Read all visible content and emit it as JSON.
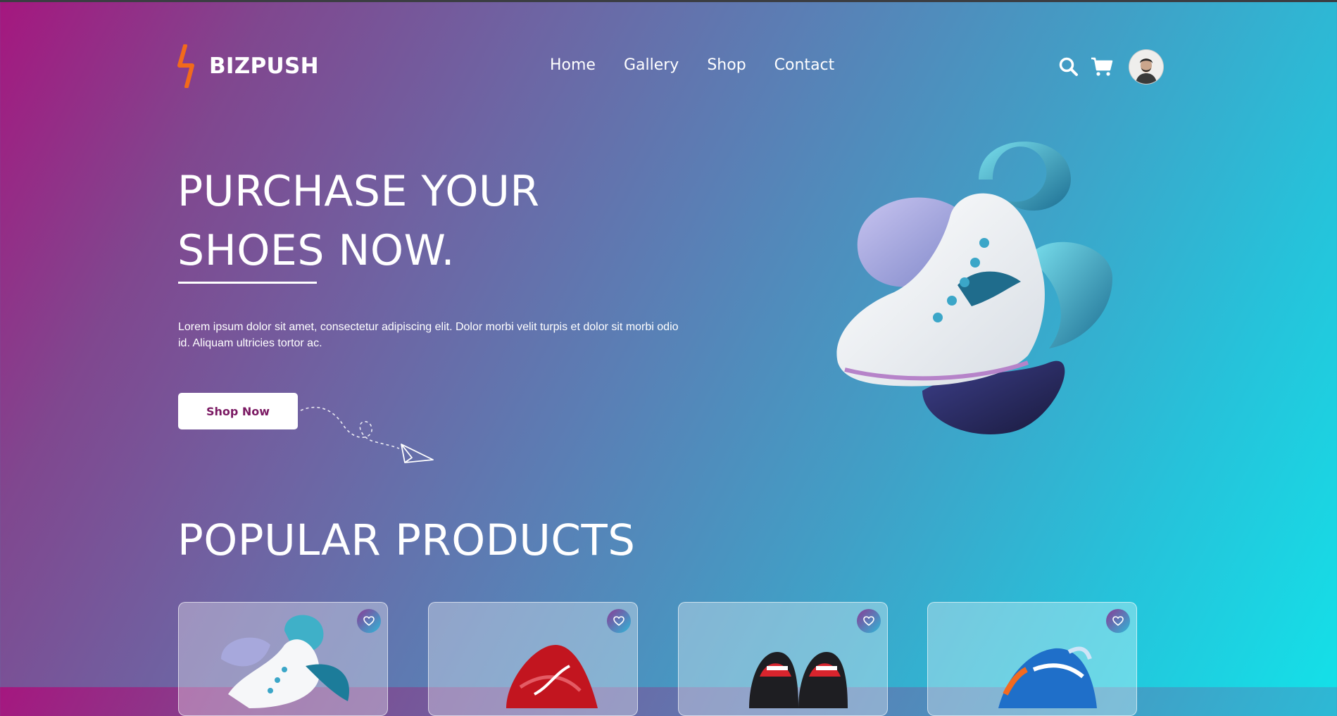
{
  "brand": {
    "name": "BIZPUSH",
    "logo_icon": "lightning-bolt-icon",
    "logo_color": "#f26a1b"
  },
  "nav": {
    "items": [
      "Home",
      "Gallery",
      "Shop",
      "Contact"
    ]
  },
  "header_icons": [
    "search-icon",
    "cart-icon",
    "avatar"
  ],
  "hero": {
    "title_line1": "PURCHASE YOUR",
    "title_line2": "SHOES NOW.",
    "description": "Lorem ipsum dolor sit amet, consectetur adipiscing elit. Dolor morbi velit turpis et dolor sit morbi odio id. Aliquam ultricies tortor ac.",
    "button_label": "Shop Now"
  },
  "popular": {
    "title": "POPULAR PRODUCTS",
    "products": [
      {
        "image": "white-teal-sneaker",
        "icon": "heart-icon"
      },
      {
        "image": "red-sneaker",
        "icon": "heart-icon"
      },
      {
        "image": "black-red-sneakers",
        "icon": "heart-icon"
      },
      {
        "image": "blue-orange-sneaker",
        "icon": "heart-icon"
      }
    ]
  },
  "colors": {
    "gradient_start": "#a5177f",
    "gradient_end": "#14e0e8",
    "button_text": "#7b1a63",
    "heart_badge": "#8a3b95"
  }
}
